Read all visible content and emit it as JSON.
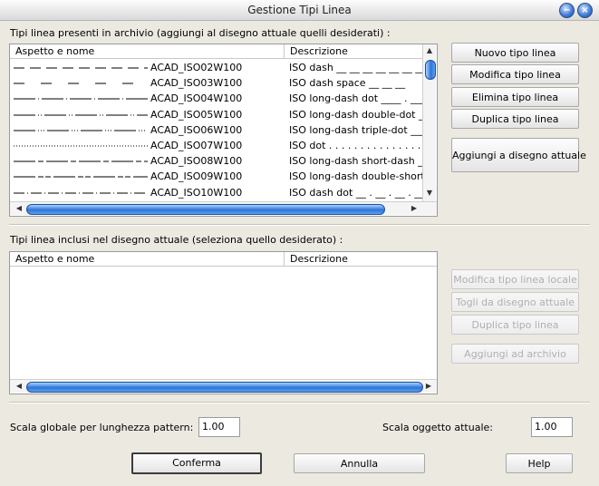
{
  "window": {
    "title": "Gestione Tipi Linea"
  },
  "top_section": {
    "label": "Tipi linea presenti in archivio (aggiungi al disegno attuale quelli desiderati) :",
    "columns": [
      "Aspetto e nome",
      "Descrizione"
    ],
    "rows": [
      {
        "name": "ACAD_ISO02W100",
        "desc": "ISO dash __ __ __ __ __ __ __",
        "pattern": "12,6"
      },
      {
        "name": "ACAD_ISO03W100",
        "desc": "ISO dash space __    __    __",
        "pattern": "12,18"
      },
      {
        "name": "ACAD_ISO04W100",
        "desc": "ISO long-dash dot ____ . ____ .",
        "pattern": "24,3,1,3"
      },
      {
        "name": "ACAD_ISO05W100",
        "desc": "ISO long-dash double-dot ____ ..",
        "pattern": "24,3,1,2,1,3"
      },
      {
        "name": "ACAD_ISO06W100",
        "desc": "ISO long-dash triple-dot ____ ...",
        "pattern": "24,3,1,2,1,2,1,3"
      },
      {
        "name": "ACAD_ISO07W100",
        "desc": "ISO dot . . . . . . . . . . . . . . .",
        "pattern": "1,2"
      },
      {
        "name": "ACAD_ISO08W100",
        "desc": "ISO long-dash short-dash ____ __",
        "pattern": "24,3,6,3"
      },
      {
        "name": "ACAD_ISO09W100",
        "desc": "ISO long-dash double-short-dash",
        "pattern": "24,3,6,2,6,3"
      },
      {
        "name": "ACAD_ISO10W100",
        "desc": "ISO dash dot __ . __ . __ . __",
        "pattern": "12,3,1,3"
      }
    ],
    "buttons": {
      "new": "Nuovo tipo linea",
      "modify": "Modifica tipo linea",
      "delete": "Elimina tipo linea",
      "duplicate": "Duplica tipo linea",
      "add_to_drawing": "Aggiungi a disegno attuale"
    }
  },
  "bottom_section": {
    "label": "Tipi linea inclusi nel disegno attuale (seleziona quello desiderato) :",
    "columns": [
      "Aspetto e nome",
      "Descrizione"
    ],
    "buttons": {
      "modify_local": "Modifica tipo linea locale",
      "remove": "Togli da disegno attuale",
      "duplicate": "Duplica tipo linea",
      "add_to_archive": "Aggiungi ad archivio"
    }
  },
  "scale": {
    "global_label": "Scala globale per lunghezza pattern:",
    "global_value": "1.00",
    "object_label": "Scala oggetto attuale:",
    "object_value": "1.00"
  },
  "footer": {
    "confirm": "Conferma",
    "cancel": "Annulla",
    "help": "Help"
  }
}
